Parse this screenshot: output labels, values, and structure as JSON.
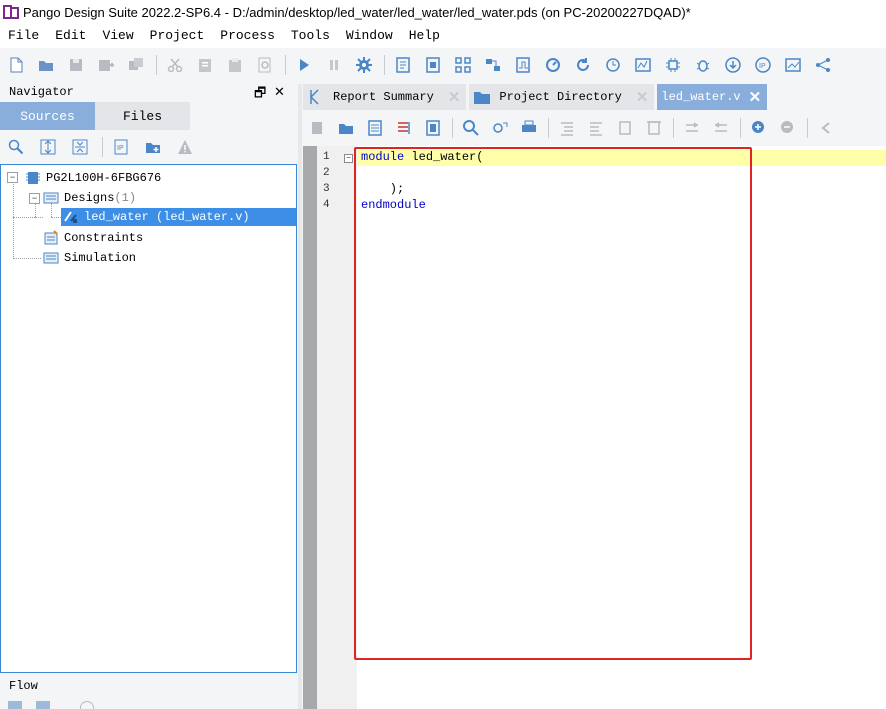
{
  "window": {
    "title": "Pango Design Suite 2022.2-SP6.4 - D:/admin/desktop/led_water/led_water/led_water.pds (on PC-20200227DQAD)*"
  },
  "menu": [
    "File",
    "Edit",
    "View",
    "Project",
    "Process",
    "Tools",
    "Window",
    "Help"
  ],
  "navigator": {
    "title": "Navigator",
    "tabs": [
      "Sources",
      "Files"
    ],
    "tree": {
      "device": "PG2L100H-6FBG676",
      "designs_label": "Designs",
      "designs_count": "(1)",
      "design_item": "led_water (led_water.v)",
      "constraints": "Constraints",
      "simulation": "Simulation"
    }
  },
  "flow": {
    "title": "Flow"
  },
  "editor": {
    "tabs": [
      "Report Summary",
      "Project Directory",
      "led_water.v"
    ],
    "active_tab": "led_water.v",
    "lines": [
      {
        "num": "1",
        "kw": "module",
        "rest": " led_water("
      },
      {
        "num": "2",
        "kw": "",
        "rest": ""
      },
      {
        "num": "3",
        "kw": "",
        "rest": "    );"
      },
      {
        "num": "4",
        "kw": "endmodule",
        "rest": ""
      }
    ]
  },
  "colors": {
    "accent": "#8aaedb",
    "selection": "#3c8ee6",
    "current_line": "#ffffaa",
    "keyword": "#0000cc",
    "highlight_box": "#e02424"
  }
}
